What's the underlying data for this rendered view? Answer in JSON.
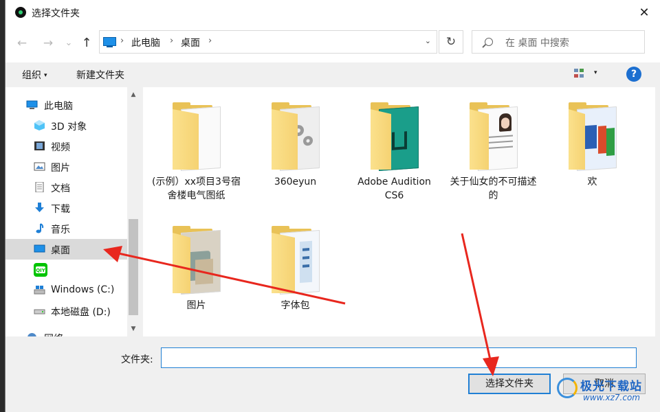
{
  "window": {
    "title": "选择文件夹",
    "close_glyph": "✕"
  },
  "navigation": {
    "back_glyph": "←",
    "forward_glyph": "→",
    "history_glyph": "⌄",
    "up_glyph": "↑",
    "breadcrumbs": [
      "此电脑",
      "桌面"
    ],
    "separator": "›",
    "dropdown_glyph": "⌄",
    "refresh_glyph": "↻",
    "search_placeholder": "在 桌面 中搜索"
  },
  "toolbar": {
    "organize_label": "组织",
    "organize_caret": "▾",
    "new_folder_label": "新建文件夹",
    "view_caret": "▾",
    "help_label": "?"
  },
  "sidebar": {
    "items": [
      {
        "label": "此电脑",
        "icon": "this-pc-icon",
        "indent": false
      },
      {
        "label": "3D 对象",
        "icon": "3d-objects-icon",
        "indent": true
      },
      {
        "label": "视频",
        "icon": "videos-icon",
        "indent": true
      },
      {
        "label": "图片",
        "icon": "pictures-icon",
        "indent": true
      },
      {
        "label": "文档",
        "icon": "documents-icon",
        "indent": true
      },
      {
        "label": "下载",
        "icon": "downloads-icon",
        "indent": true
      },
      {
        "label": "音乐",
        "icon": "music-icon",
        "indent": true
      },
      {
        "label": "桌面",
        "icon": "desktop-icon",
        "indent": true,
        "selected": true
      },
      {
        "label": "",
        "icon": "iqiyi-icon",
        "indent": true
      },
      {
        "label": "Windows (C:)",
        "icon": "drive-c-icon",
        "indent": true
      },
      {
        "label": "本地磁盘 (D:)",
        "icon": "drive-d-icon",
        "indent": true
      },
      {
        "label": "网络",
        "icon": "network-icon",
        "indent": false
      }
    ],
    "scroll_up_glyph": "▲",
    "scroll_down_glyph": "▼"
  },
  "folders": [
    {
      "name": "(示例）xx项目3号宿舍楼电气图纸"
    },
    {
      "name": "360eyun"
    },
    {
      "name": "Adobe Audition CS6"
    },
    {
      "name": "关于仙女的不可描述的"
    },
    {
      "name": "欢"
    },
    {
      "name": "图片"
    },
    {
      "name": "字体包"
    }
  ],
  "bottom": {
    "folder_label": "文件夹:",
    "folder_value": "",
    "select_button": "选择文件夹",
    "cancel_button": "取消"
  },
  "watermark": {
    "title": "极光下载站",
    "url": "www.xz7.com"
  },
  "colors": {
    "accent": "#1f7fd4",
    "selected_bg": "#cce4f7",
    "annotation_arrow": "#e8271e"
  }
}
